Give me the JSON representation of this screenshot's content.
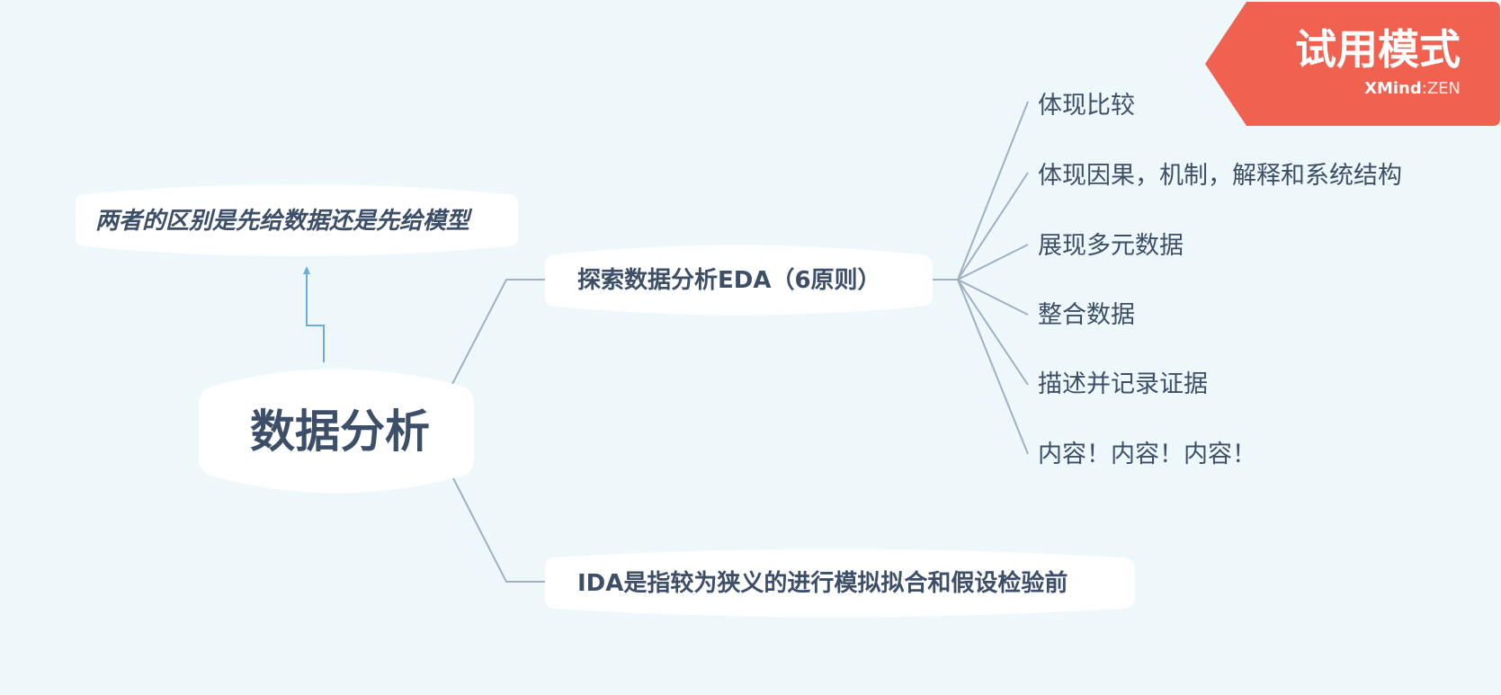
{
  "central_topic": "数据分析",
  "note": "两者的区别是先给数据还是先给模型",
  "branches": [
    {
      "label": "探索数据分析EDA（6原则）",
      "children": [
        "体现比较",
        "体现因果，机制，解释和系统结构",
        "展现多元数据",
        "整合数据",
        "描述并记录证据",
        "内容！内容！内容！"
      ]
    },
    {
      "label": "IDA是指较为狭义的进行模拟拟合和假设检验前",
      "children": []
    }
  ],
  "trial_badge": {
    "title": "试用模式",
    "brand_bold": "XMind",
    "brand_sep": ":",
    "brand_light": "ZEN"
  },
  "colors": {
    "background": "#eef8fa",
    "topic_fill": "#ffffff",
    "text": "#3d4e68",
    "connector": "#9fb0c3",
    "arrow": "#6aaed6",
    "badge": "#f0624f"
  }
}
